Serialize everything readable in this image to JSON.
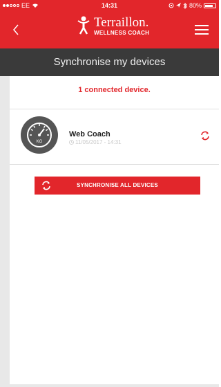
{
  "status_bar": {
    "carrier": "EE",
    "time": "14:31",
    "battery": "80%",
    "battery_level": 0.8
  },
  "header": {
    "back_icon": "chevron-left-icon",
    "brand": "Terraillon.",
    "subtitle": "WELLNESS COACH",
    "menu_icon": "hamburger-menu-icon"
  },
  "page": {
    "title": "Synchronise my devices",
    "connected_text": "1 connected device."
  },
  "devices": [
    {
      "name": "Web Coach",
      "last_sync": "11/05/2017 - 14:31",
      "avatar_label": "KG",
      "icon": "scale-gauge-icon",
      "refresh_icon": "refresh-icon"
    }
  ],
  "actions": {
    "sync_all_label": "SYNCHRONISE ALL DEVICES",
    "sync_all_icon": "refresh-icon"
  },
  "colors": {
    "accent": "#e2262b",
    "banner": "#3a3a3a"
  }
}
